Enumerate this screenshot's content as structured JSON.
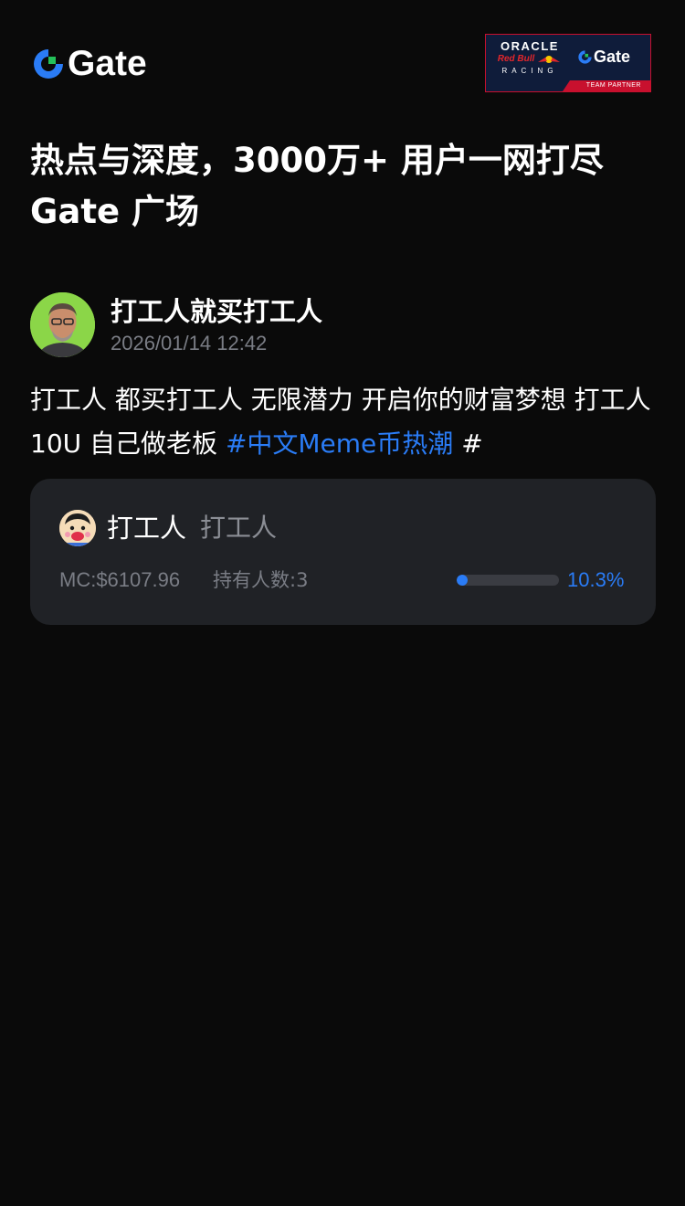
{
  "header": {
    "logo_text": "Gate",
    "partner_badge": {
      "oracle": "ORACLE",
      "redbull": "Red Bull",
      "racing": "RACING",
      "gate_text": "Gate",
      "partner_label": "TEAM PARTNER"
    }
  },
  "headline": {
    "line1": "热点与深度，3000万+ 用户一网打尽",
    "line2": "Gate 广场"
  },
  "post": {
    "author_name": "打工人就买打工人",
    "timestamp": "2026/01/14 12:42",
    "body_text": "打工人 都买打工人  无限潜力  开启你的财富梦想 打工人10U 自己做老板 ",
    "hashtag": "#中文Meme币热潮",
    "trailing_hash": " #"
  },
  "token_card": {
    "name": "打工人",
    "symbol": "打工人",
    "market_cap": "MC:$6107.96",
    "holders": "持有人数:3",
    "progress_percent": 10.3,
    "progress_label": "10.3%"
  },
  "colors": {
    "background": "#0a0a0a",
    "card": "#202226",
    "accent_blue": "#2a7cf6",
    "muted_text": "#7a7d85",
    "brand_red": "#c8102e"
  }
}
